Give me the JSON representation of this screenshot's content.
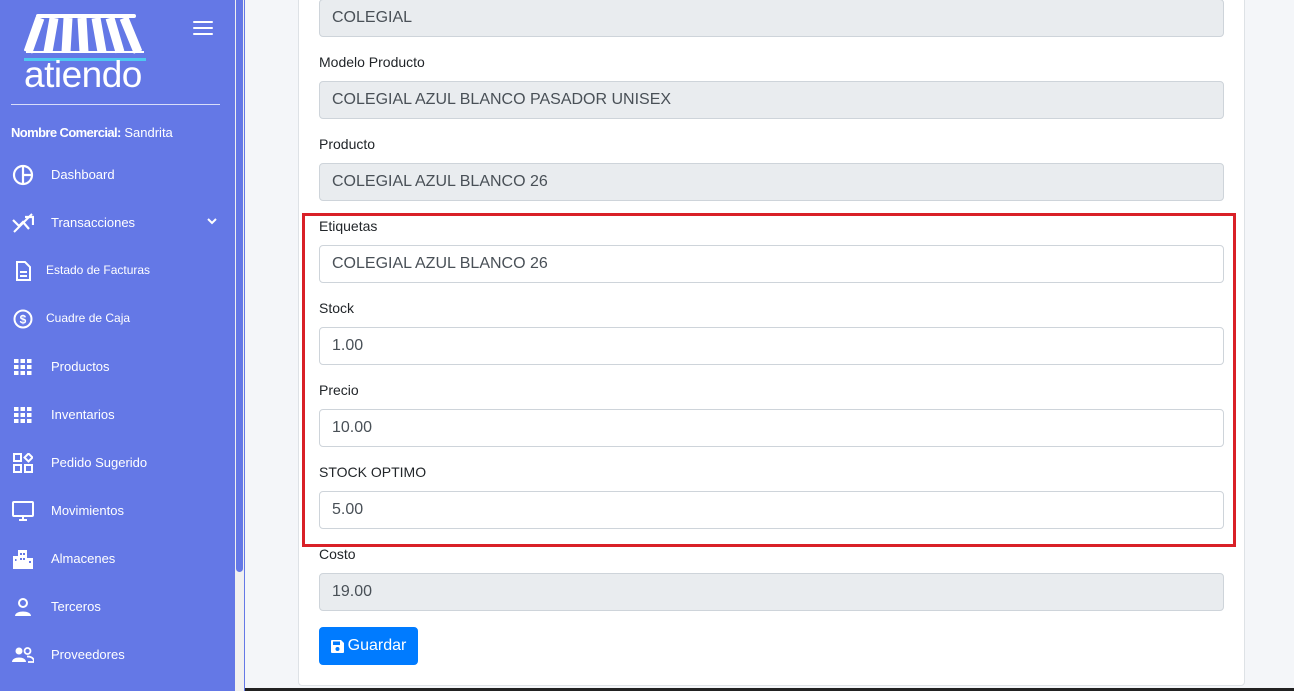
{
  "sidebar": {
    "logo_text": "atiendo",
    "brand_label": "Nombre Comercial:",
    "brand_value": "Sandrita",
    "items": [
      {
        "label": "Dashboard",
        "icon": "dashboard-icon"
      },
      {
        "label": "Transacciones",
        "icon": "transactions-icon",
        "has_submenu": true
      },
      {
        "label": "Estado de Facturas",
        "icon": "document-icon"
      },
      {
        "label": "Cuadre de Caja",
        "icon": "dollar-circle-icon"
      },
      {
        "label": "Productos",
        "icon": "grid-icon"
      },
      {
        "label": "Inventarios",
        "icon": "grid-icon"
      },
      {
        "label": "Pedido Sugerido",
        "icon": "widgets-icon"
      },
      {
        "label": "Movimientos",
        "icon": "monitor-icon"
      },
      {
        "label": "Almacenes",
        "icon": "building-icon"
      },
      {
        "label": "Terceros",
        "icon": "person-icon"
      },
      {
        "label": "Proveedores",
        "icon": "people-icon"
      }
    ]
  },
  "form": {
    "categoria_value": "COLEGIAL",
    "modelo_label": "Modelo Producto",
    "modelo_value": "COLEGIAL AZUL BLANCO PASADOR UNISEX",
    "producto_label": "Producto",
    "producto_value": "COLEGIAL AZUL BLANCO 26",
    "etiquetas_label": "Etiquetas",
    "etiquetas_value": "COLEGIAL AZUL BLANCO 26",
    "stock_label": "Stock",
    "stock_value": "1.00",
    "precio_label": "Precio",
    "precio_value": "10.00",
    "stock_optimo_label": "STOCK OPTIMO",
    "stock_optimo_value": "5.00",
    "costo_label": "Costo",
    "costo_value": "19.00",
    "save_label": "Guardar"
  },
  "colors": {
    "sidebar": "#6478e6",
    "accent": "#007bff",
    "highlight": "#d92027",
    "readonly": "#e9ecef"
  }
}
